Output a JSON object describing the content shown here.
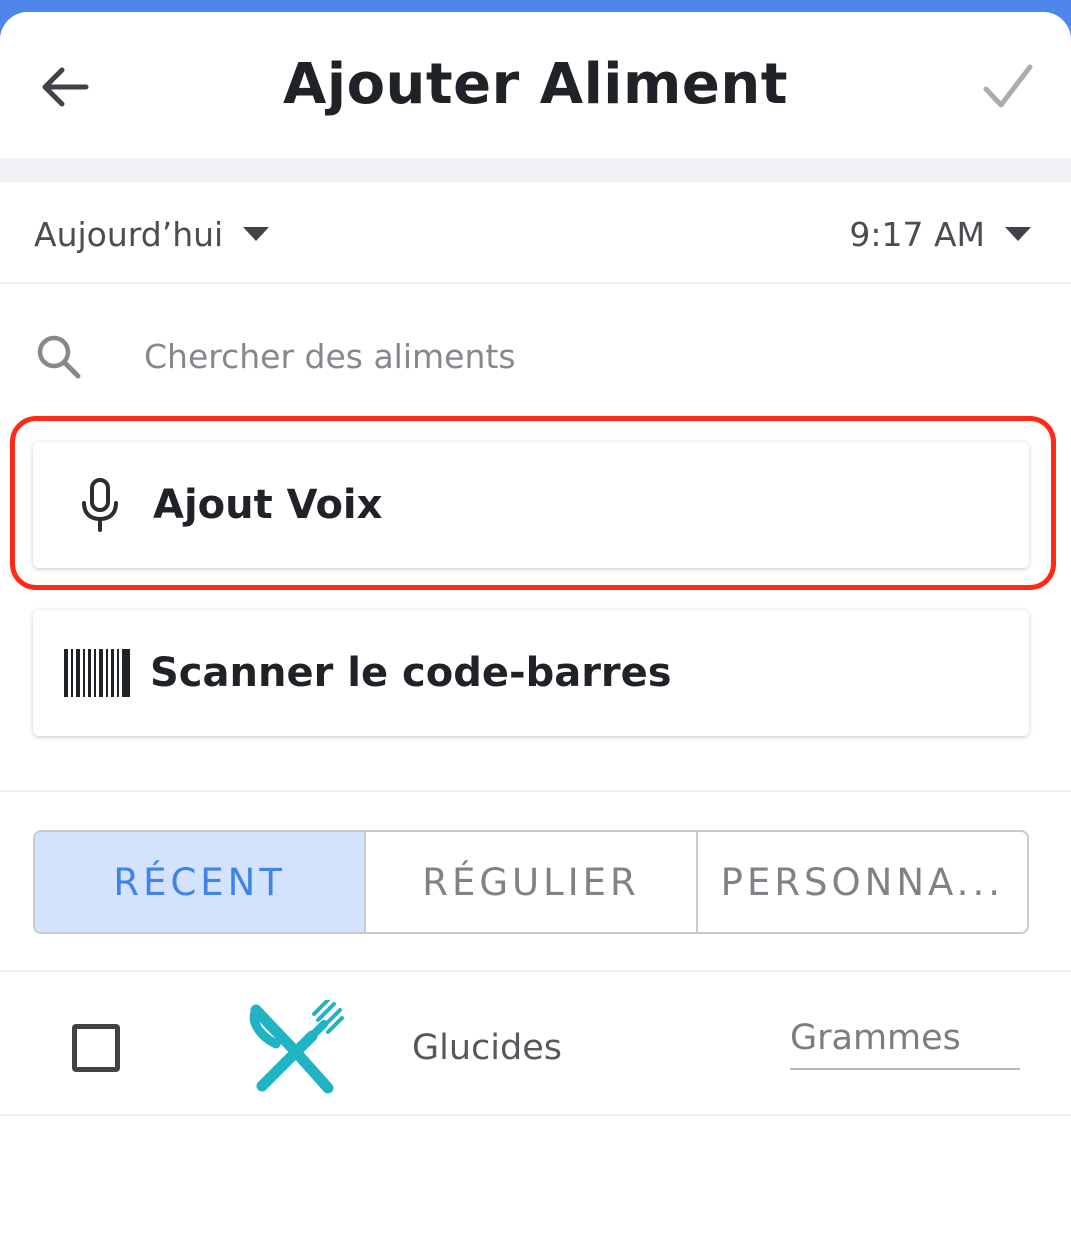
{
  "header": {
    "title": "Ajouter Aliment",
    "back_icon": "arrow-left-icon",
    "confirm_icon": "check-icon"
  },
  "datetime": {
    "date": "Aujourd’hui",
    "time": "9:17 AM"
  },
  "search": {
    "placeholder": "Chercher des aliments",
    "value": ""
  },
  "actions": {
    "voice_label": "Ajout Voix",
    "barcode_label": "Scanner le code-barres"
  },
  "tabs": [
    {
      "label": "RÉCENT",
      "active": true
    },
    {
      "label": "RÉGULIER",
      "active": false
    },
    {
      "label": "PERSONNA...",
      "active": false
    }
  ],
  "food_row": {
    "name": "Glucides",
    "unit": "Grammes",
    "checked": false,
    "icon": "fork-knife-icon"
  },
  "colors": {
    "accent": "#3f83e8",
    "active_tab_bg": "#d3e2fd",
    "highlight": "#ff2a16",
    "food_icon": "#1fb3c4",
    "top_bar": "#4f86ec"
  }
}
